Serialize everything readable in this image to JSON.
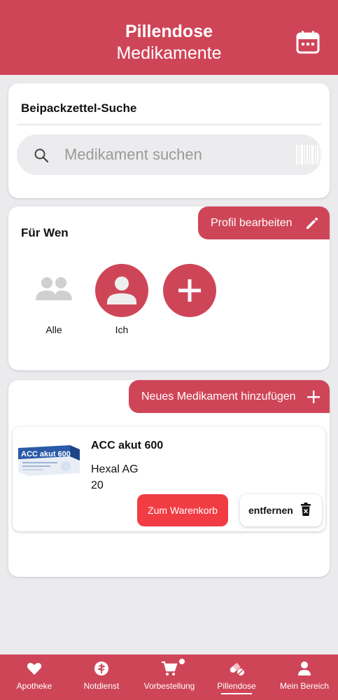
{
  "header": {
    "title": "Pillendose",
    "subtitle": "Medikamente",
    "calendar_icon": "calendar-icon"
  },
  "search_section": {
    "title": "Beipackzettel-Suche",
    "placeholder": "Medikament suchen",
    "icons": [
      "search-icon",
      "barcode-icon"
    ]
  },
  "profiles_section": {
    "title": "Für Wen",
    "edit_label": "Profil bearbeiten",
    "profiles": [
      {
        "label": "Alle",
        "icon": "group-icon"
      },
      {
        "label": "Ich",
        "icon": "person-icon"
      },
      {
        "label": "",
        "icon": "add-icon"
      }
    ]
  },
  "medications_section": {
    "add_label": "Neues Medikament hinzufügen",
    "items": [
      {
        "name": "ACC akut 600",
        "manufacturer": "Hexal AG",
        "quantity": "20",
        "cart_label": "Zum Warenkorb",
        "remove_label": "entfernen",
        "image_text": "ACC akut 600"
      }
    ]
  },
  "nav": {
    "items": [
      {
        "label": "Apotheke",
        "icon": "heart-icon"
      },
      {
        "label": "Notdienst",
        "icon": "pharmacy-symbol-icon"
      },
      {
        "label": "Vorbestellung",
        "icon": "cart-icon"
      },
      {
        "label": "Pillendose",
        "icon": "pills-icon",
        "active": true
      },
      {
        "label": "Mein Bereich",
        "icon": "person-icon"
      }
    ]
  },
  "colors": {
    "brand": "#cf4558",
    "cart_button": "#f13c44",
    "background": "#ebebee"
  }
}
